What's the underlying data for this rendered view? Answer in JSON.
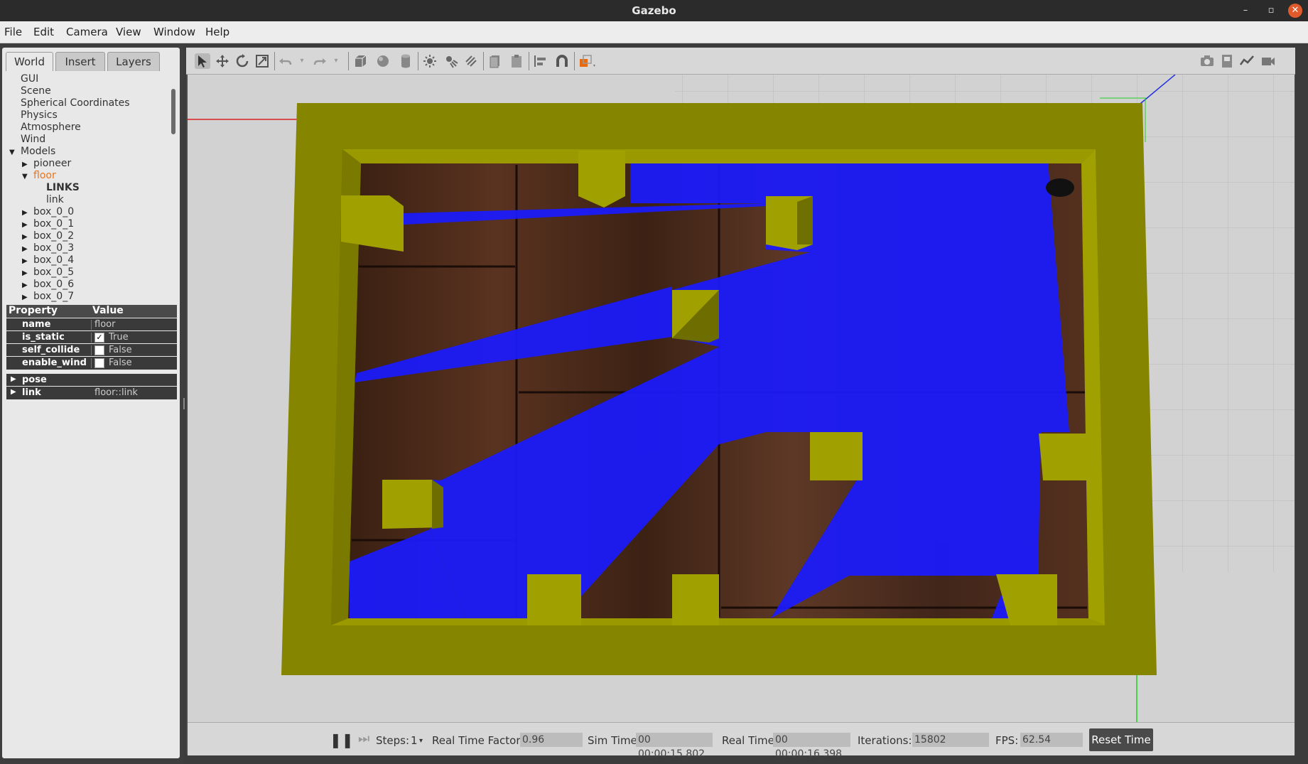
{
  "window": {
    "title": "Gazebo"
  },
  "menu": [
    "File",
    "Edit",
    "Camera",
    "View",
    "Window",
    "Help"
  ],
  "tabs": [
    "World",
    "Insert",
    "Layers"
  ],
  "tree": [
    {
      "label": "GUI",
      "indent": 0,
      "arrow": ""
    },
    {
      "label": "Scene",
      "indent": 0,
      "arrow": ""
    },
    {
      "label": "Spherical Coordinates",
      "indent": 0,
      "arrow": ""
    },
    {
      "label": "Physics",
      "indent": 0,
      "arrow": ""
    },
    {
      "label": "Atmosphere",
      "indent": 0,
      "arrow": ""
    },
    {
      "label": "Wind",
      "indent": 0,
      "arrow": ""
    },
    {
      "label": "Models",
      "indent": 0,
      "arrow": "expanded"
    },
    {
      "label": "pioneer",
      "indent": 1,
      "arrow": "collapsed"
    },
    {
      "label": "floor",
      "indent": 1,
      "arrow": "expanded"
    },
    {
      "label": "LINKS",
      "indent": 2,
      "arrow": ""
    },
    {
      "label": "link",
      "indent": 2,
      "arrow": ""
    },
    {
      "label": "box_0_0",
      "indent": 1,
      "arrow": "collapsed"
    },
    {
      "label": "box_0_1",
      "indent": 1,
      "arrow": "collapsed"
    },
    {
      "label": "box_0_2",
      "indent": 1,
      "arrow": "collapsed"
    },
    {
      "label": "box_0_3",
      "indent": 1,
      "arrow": "collapsed"
    },
    {
      "label": "box_0_4",
      "indent": 1,
      "arrow": "collapsed"
    },
    {
      "label": "box_0_5",
      "indent": 1,
      "arrow": "collapsed"
    },
    {
      "label": "box_0_6",
      "indent": 1,
      "arrow": "collapsed"
    },
    {
      "label": "box_0_7",
      "indent": 1,
      "arrow": "collapsed"
    }
  ],
  "tree_selected": "floor",
  "tree_selected_color": "#e8731a",
  "properties": {
    "header_property": "Property",
    "header_value": "Value",
    "rows": [
      {
        "key": "name",
        "value": "floor",
        "checkbox": null
      },
      {
        "key": "is_static",
        "value": "True",
        "checkbox": true
      },
      {
        "key": "self_collide",
        "value": "False",
        "checkbox": false
      },
      {
        "key": "enable_wind",
        "value": "False",
        "checkbox": false
      }
    ],
    "groups": [
      {
        "key": "pose",
        "value": ""
      },
      {
        "key": "link",
        "value": "floor::link"
      }
    ]
  },
  "toolbar_icons": [
    "select-icon",
    "translate-icon",
    "rotate-icon",
    "scale-icon",
    "undo-icon",
    "undo-history-icon",
    "redo-icon",
    "redo-history-icon",
    "box-shape-icon",
    "sphere-shape-icon",
    "cylinder-shape-icon",
    "point-light-icon",
    "spot-light-icon",
    "directional-light-icon",
    "copy-icon",
    "paste-icon",
    "align-icon",
    "snap-icon",
    "change-view-icon",
    "screenshot-icon",
    "log-icon",
    "plot-icon",
    "record-video-icon"
  ],
  "bottom": {
    "steps_label": "Steps:",
    "steps_value": "1",
    "rtf_label": "Real Time Factor:",
    "rtf_value": "0.96",
    "sim_time_label": "Sim Time:",
    "sim_time_value": "00 00:00:15.802",
    "real_time_label": "Real Time:",
    "real_time_value": "00 00:00:16.398",
    "iterations_label": "Iterations:",
    "iterations_value": "15802",
    "fps_label": "FPS:",
    "fps_value": "62.54",
    "reset_label": "Reset Time"
  },
  "colors": {
    "wall": "#858500",
    "wall_light": "#a0a000",
    "laser": "#1a1aff",
    "floor_wood": "#4a2a18",
    "ground": "#d2d2d2"
  }
}
